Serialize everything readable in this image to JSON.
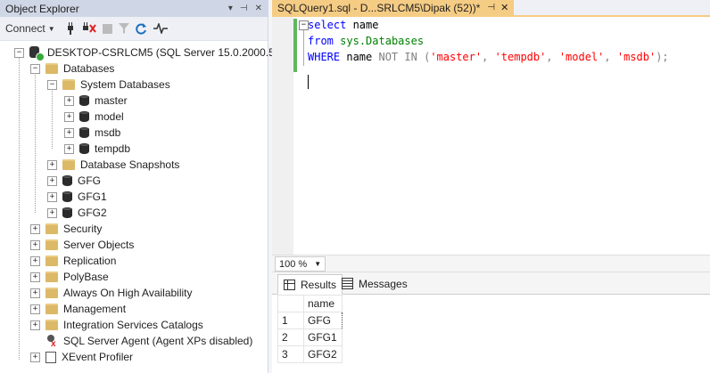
{
  "object_explorer": {
    "title": "Object Explorer",
    "title_controls": [
      "▾",
      "⊣",
      "✕"
    ],
    "toolbar": {
      "connect_label": "Connect",
      "icons": [
        "connect-plug-icon",
        "disconnect-icon",
        "stop-icon",
        "filter-icon",
        "refresh-icon",
        "activity-monitor-icon"
      ]
    },
    "server": "DESKTOP-CSRLCM5 (SQL Server 15.0.2000.5 - D",
    "databases_label": "Databases",
    "system_databases_label": "System Databases",
    "system_databases": [
      "master",
      "model",
      "msdb",
      "tempdb"
    ],
    "snapshots_label": "Database Snapshots",
    "user_databases": [
      "GFG",
      "GFG1",
      "GFG2"
    ],
    "folders": [
      "Security",
      "Server Objects",
      "Replication",
      "PolyBase",
      "Always On High Availability",
      "Management",
      "Integration Services Catalogs"
    ],
    "agent_label": "SQL Server Agent (Agent XPs disabled)",
    "xevent_label": "XEvent Profiler"
  },
  "editor": {
    "tab_label": "SQLQuery1.sql - D...SRLCM5\\Dipak (52))*",
    "tab_pin": "⊣",
    "tab_close": "✕",
    "line1": {
      "kw": "select",
      "rest": " name"
    },
    "line2": {
      "kw": "from",
      "sp": " ",
      "obj": "sys.Databases"
    },
    "line3": {
      "kw1": "WHERE",
      "name": " name ",
      "kw2": "NOT IN",
      "sp": " ",
      "open": "(",
      "s1": "'master'",
      "c1": ", ",
      "s2": "'tempdb'",
      "c2": ", ",
      "s3": "'model'",
      "c3": ", ",
      "s4": "'msdb'",
      "close": ");"
    },
    "zoom": "100 %"
  },
  "results": {
    "tabs": [
      "Results",
      "Messages"
    ],
    "column": "name",
    "rows": [
      {
        "n": "1",
        "name": "GFG"
      },
      {
        "n": "2",
        "name": "GFG1"
      },
      {
        "n": "3",
        "name": "GFG2"
      }
    ]
  }
}
